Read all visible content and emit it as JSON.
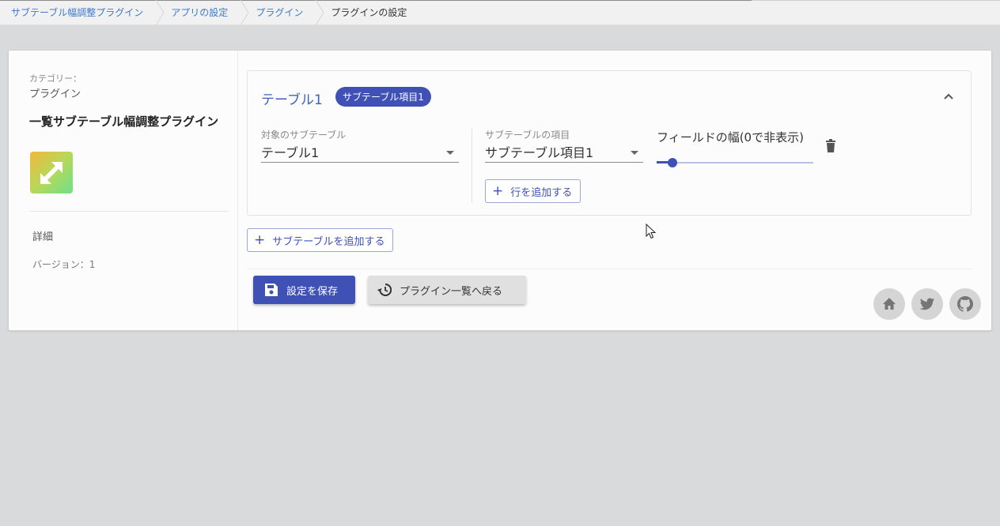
{
  "breadcrumb": [
    {
      "label": "サブテーブル幅調整プラグイン"
    },
    {
      "label": "アプリの設定"
    },
    {
      "label": "プラグイン"
    },
    {
      "label": "プラグインの設定"
    }
  ],
  "sidebar": {
    "category_label": "カテゴリー：",
    "category_value": "プラグイン",
    "plugin_name": "一覧サブテーブル幅調整プラグイン",
    "detail_label": "詳細",
    "version_label": "バージョン：1"
  },
  "subtable": {
    "title": "テーブル1",
    "chip": "サブテーブル項目1",
    "target_label": "対象のサブテーブル",
    "target_value": "テーブル1",
    "item_label": "サブテーブルの項目",
    "item_value": "サブテーブル項目1",
    "width_label": "フィールドの幅(0で非表示)",
    "width_slider_fraction": 0.1,
    "add_row_label": "行を追加する"
  },
  "add_subtable_label": "サブテーブルを追加する",
  "actions": {
    "save_label": "設定を保存",
    "back_label": "プラグイン一覧へ戻る"
  },
  "footer_icons": [
    "home-icon",
    "twitter-icon",
    "github-icon"
  ],
  "colors": {
    "primary": "#3f51b5",
    "link": "#3f79c7",
    "background": "#d9dadc",
    "icon_button_bg": "#d5d5d5"
  }
}
